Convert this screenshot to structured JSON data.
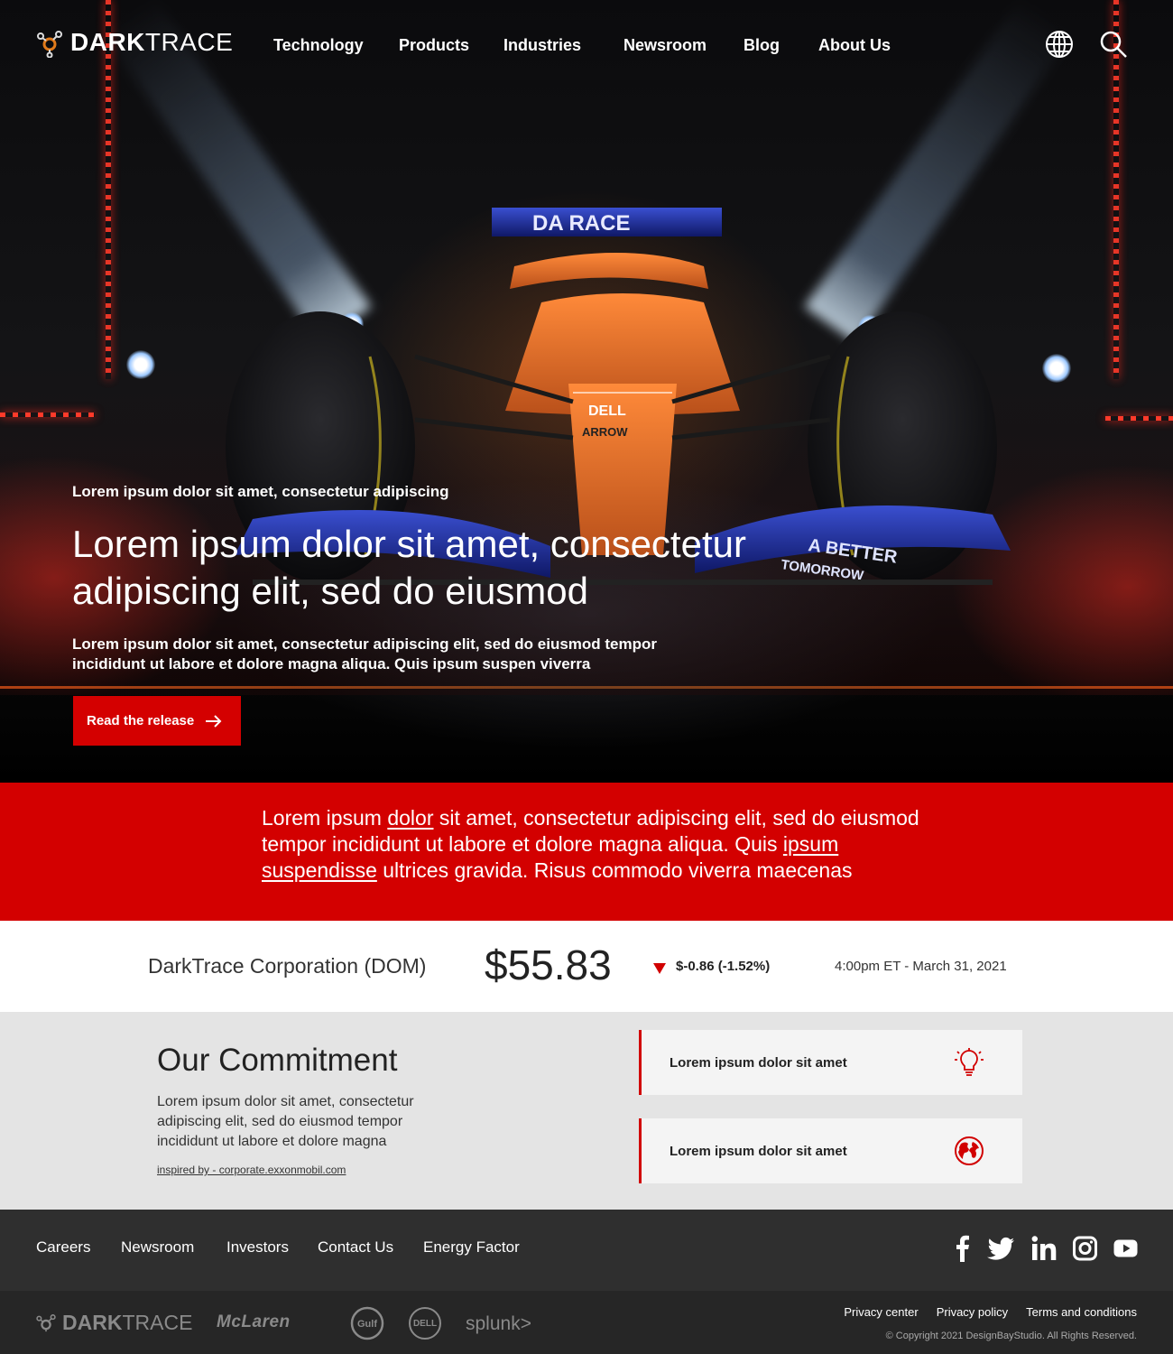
{
  "brand": {
    "name_bold": "DARK",
    "name_light": "TRACE",
    "accent": "#d30000"
  },
  "nav": {
    "items": [
      "Technology",
      "Products",
      "Industries",
      "Newsroom",
      "Blog",
      "About Us"
    ],
    "icons": [
      "globe-icon",
      "search-icon"
    ]
  },
  "hero": {
    "eyebrow": "Lorem ipsum dolor sit amet, consectetur adipiscing",
    "headline": "Lorem ipsum dolor sit amet, consectetur adipiscing elit, sed do eiusmod",
    "sub": "Lorem ipsum dolor sit amet, consectetur adipiscing elit, sed do eiusmod tempor incididunt ut labore et dolore magna aliqua. Quis ipsum suspen viverra",
    "cta": "Read the release",
    "car_livery": {
      "wing_text": "DA    RACE",
      "side_text": "A BETTER",
      "side_text_2": "TOMORROW",
      "sponsor": "DELL",
      "sponsor_2": "ARROW"
    }
  },
  "band": {
    "t1": "Lorem ipsum ",
    "link1": "dolor",
    "t2": " sit amet, consectetur adipiscing elit, sed do eiusmod tempor incididunt ut labore et dolore magna aliqua. Quis ",
    "link2": "ipsum suspendisse",
    "t3": " ultrices gravida. Risus commodo viverra maecenas"
  },
  "stock": {
    "name": "DarkTrace Corporation (DOM)",
    "price": "$55.83",
    "change": "$-0.86 (-1.52%)",
    "direction": "down",
    "time": "4:00pm ET - March 31, 2021"
  },
  "commitment": {
    "title": "Our Commitment",
    "desc": "Lorem ipsum dolor sit amet, consectetur adipiscing elit, sed do eiusmod tempor incididunt ut labore et dolore magna",
    "credit": "inspired by - corporate.exxonmobil.com",
    "cards": [
      {
        "label": "Lorem ipsum dolor sit amet",
        "icon": "lightbulb-icon"
      },
      {
        "label": "Lorem ipsum dolor sit amet",
        "icon": "globe-icon"
      }
    ]
  },
  "footer": {
    "links": [
      "Careers",
      "Newsroom",
      "Investors",
      "Contact Us",
      "Energy Factor"
    ],
    "social": [
      "facebook-icon",
      "twitter-icon",
      "linkedin-icon",
      "instagram-icon",
      "youtube-icon"
    ],
    "partners": [
      "McLaren",
      "Gulf",
      "DELL",
      "splunk>"
    ],
    "legal": [
      "Privacy center",
      "Privacy policy",
      "Terms and conditions"
    ],
    "copyright": "© Copyright 2021 DesignBayStudio. All Rights Reserved."
  }
}
